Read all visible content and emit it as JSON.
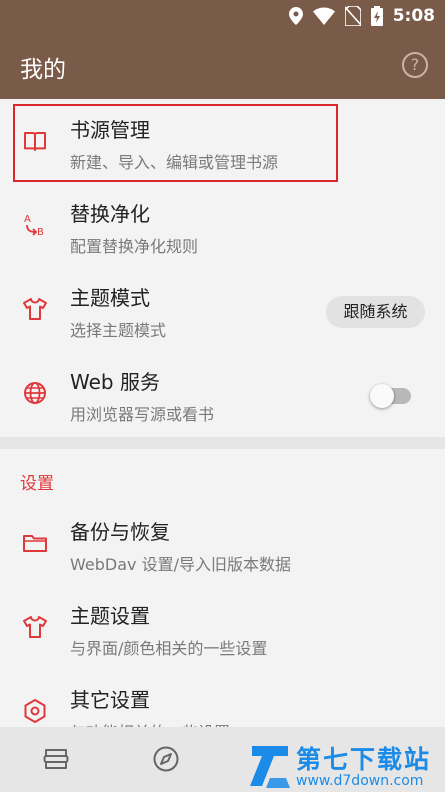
{
  "status_bar": {
    "time": "5:08",
    "icons": [
      "location-icon",
      "wifi-icon",
      "no-sim-icon",
      "battery-charging-icon"
    ]
  },
  "app_bar": {
    "title": "我的",
    "help_icon": "help-circle-icon",
    "help_glyph": "?"
  },
  "main_items": [
    {
      "title": "书源管理",
      "summary": "新建、导入、编辑或管理书源",
      "icon": "book-open-icon"
    },
    {
      "title": "替换净化",
      "summary": "配置替换净化规则",
      "icon": "replace-ab-icon"
    },
    {
      "title": "主题模式",
      "summary": "选择主题模式",
      "icon": "tshirt-icon",
      "value": "跟随系统"
    },
    {
      "title": "Web 服务",
      "summary": "用浏览器写源或看书",
      "icon": "globe-icon",
      "switch_on": false
    }
  ],
  "settings_section": {
    "header": "设置",
    "items": [
      {
        "title": "备份与恢复",
        "summary": "WebDav 设置/导入旧版本数据",
        "icon": "folder-icon"
      },
      {
        "title": "主题设置",
        "summary": "与界面/颜色相关的一些设置",
        "icon": "tshirt-icon"
      },
      {
        "title": "其它设置",
        "summary": "与功能相关的一些设置",
        "icon": "settings-hexagon-icon"
      }
    ]
  },
  "bottom_nav": {
    "items": [
      "bookshelf-icon",
      "compass-icon"
    ]
  },
  "watermark": {
    "text": "第七下载站",
    "url": "www.d7down.com"
  },
  "colors": {
    "primary": "#7a5a48",
    "accent": "#e0393b",
    "highlight_border": "#d9272e",
    "watermark": "#1c8be8"
  }
}
